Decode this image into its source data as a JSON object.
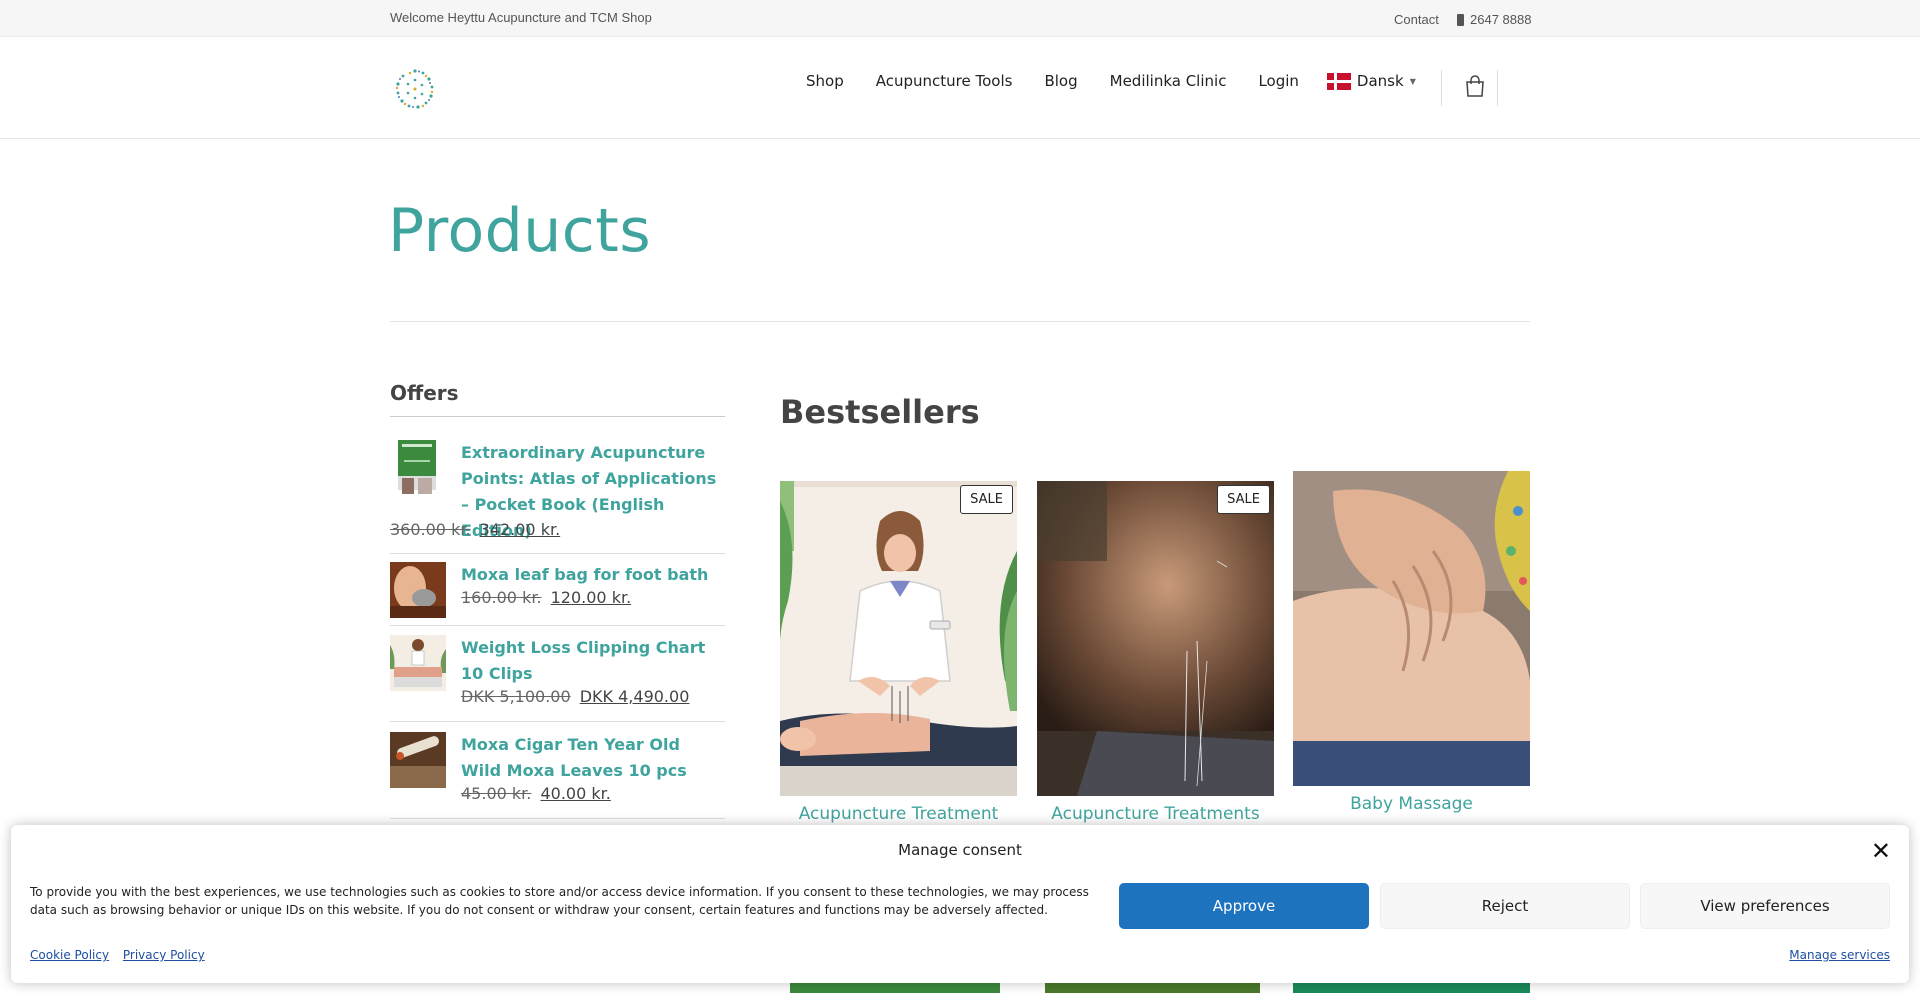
{
  "topbar": {
    "welcome": "Welcome Heyttu Acupuncture and TCM Shop",
    "contact": "Contact",
    "phone": "2647 8888"
  },
  "nav": {
    "items": [
      "Shop",
      "Acupuncture Tools",
      "Blog",
      "Medilinka Clinic",
      "Login"
    ],
    "language": "Dansk"
  },
  "page": {
    "title": "Products"
  },
  "offers": {
    "title": "Offers",
    "items": [
      {
        "name": "Extraordinary Acupuncture Points: Atlas of Applications – Pocket Book (English Edition)",
        "old_price": "360.00  kr.",
        "new_price": "342.00  kr."
      },
      {
        "name": "Moxa leaf bag for foot bath",
        "old_price": "160.00  kr.",
        "new_price": "120.00  kr."
      },
      {
        "name": "Weight Loss Clipping Chart 10 Clips",
        "old_price": "DKK 5,100.00",
        "new_price": "DKK 4,490.00"
      },
      {
        "name": "Moxa Cigar Ten Year Old Wild Moxa Leaves 10 pcs",
        "old_price": "45.00  kr.",
        "new_price": "40.00  kr."
      }
    ]
  },
  "bestsellers": {
    "title": "Bestsellers",
    "products": [
      {
        "name": "Acupuncture Treatment",
        "badge": "SALE"
      },
      {
        "name": "Acupuncture Treatments",
        "badge": "SALE"
      },
      {
        "name": "Baby Massage",
        "badge": ""
      }
    ]
  },
  "cookie": {
    "title": "Manage consent",
    "text": "To provide you with the best experiences, we use technologies such as cookies to store and/or access device information. If you consent to these technologies, we may process data such as browsing behavior or unique IDs on this website. If you do not consent or withdraw your consent, certain features and functions may be adversely affected.",
    "approve": "Approve",
    "reject": "Reject",
    "preferences": "View preferences",
    "cookie_policy": "Cookie Policy",
    "privacy_policy": "Privacy Policy",
    "manage_services": "Manage services",
    "close": "✕"
  },
  "colors": {
    "accent": "#3fa49d",
    "approve": "#1e73be"
  }
}
